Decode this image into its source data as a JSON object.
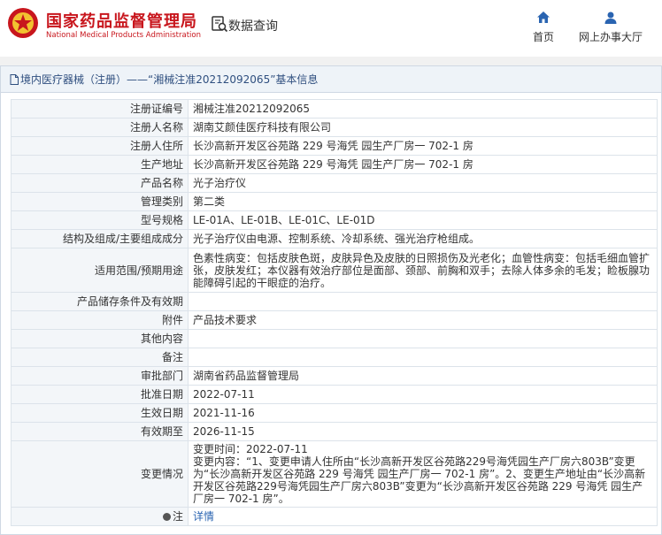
{
  "header": {
    "logo_cn": "国家药品监督管理局",
    "logo_en": "National Medical Products Administration",
    "query_label": "数据查询",
    "nav": {
      "home": "首页",
      "online_office": "网上办事大厅"
    },
    "brand_color": "#c8161d"
  },
  "panel": {
    "title": "境内医疗器械（注册）——“湘械注准20212092065”基本信息"
  },
  "rows": [
    {
      "label": "注册证编号",
      "value": "湘械注准20212092065"
    },
    {
      "label": "注册人名称",
      "value": "湖南艾颜佳医疗科技有限公司"
    },
    {
      "label": "注册人住所",
      "value": "长沙高新开发区谷苑路 229 号海凭 园生产厂房一 702-1 房"
    },
    {
      "label": "生产地址",
      "value": "长沙高新开发区谷苑路 229 号海凭 园生产厂房一 702-1 房"
    },
    {
      "label": "产品名称",
      "value": "光子治疗仪"
    },
    {
      "label": "管理类别",
      "value": "第二类"
    },
    {
      "label": "型号规格",
      "value": "LE-01A、LE-01B、LE-01C、LE-01D"
    },
    {
      "label": "结构及组成/主要组成成分",
      "value": "光子治疗仪由电源、控制系统、冷却系统、强光治疗枪组成。"
    },
    {
      "label": "适用范围/预期用途",
      "value": "色素性病变：包括皮肤色斑，皮肤异色及皮肤的日照损伤及光老化；血管性病变：包括毛细血管扩张，皮肤发红；本仪器有效治疗部位是面部、颈部、前胸和双手；去除人体多余的毛发；睑板腺功能障碍引起的干眼症的治疗。"
    },
    {
      "label": "产品储存条件及有效期",
      "value": ""
    },
    {
      "label": "附件",
      "value": "产品技术要求"
    },
    {
      "label": "其他内容",
      "value": ""
    },
    {
      "label": "备注",
      "value": ""
    },
    {
      "label": "审批部门",
      "value": "湖南省药品监督管理局"
    },
    {
      "label": "批准日期",
      "value": "2022-07-11"
    },
    {
      "label": "生效日期",
      "value": "2021-11-16"
    },
    {
      "label": "有效期至",
      "value": "2026-11-15"
    },
    {
      "label": "变更情况",
      "value": "变更时间：2022-07-11\n变更内容：“1、变更申请人住所由“长沙高新开发区谷苑路229号海凭园生产厂房六803B”变更为“长沙高新开发区谷苑路 229 号海凭 园生产厂房一 702-1 房”。2、变更生产地址由“长沙高新开发区谷苑路229号海凭园生产厂房六803B”变更为“长沙高新开发区谷苑路 229 号海凭 园生产厂房一 702-1 房”。"
    }
  ],
  "note": {
    "label": "注",
    "link": "详情"
  }
}
